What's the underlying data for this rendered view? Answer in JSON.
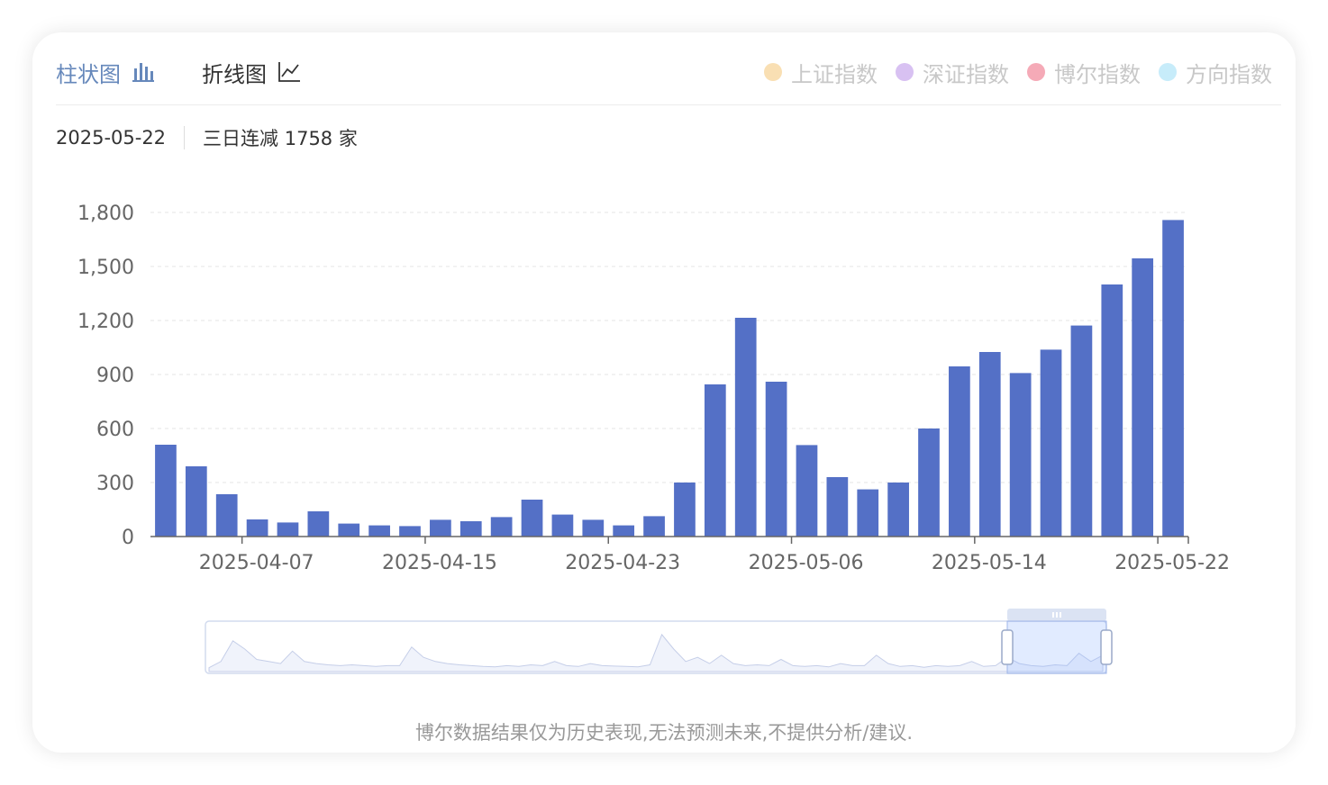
{
  "tabs": {
    "bar_label": "柱状图",
    "line_label": "折线图"
  },
  "legend": [
    {
      "label": "上证指数",
      "color": "#f9dfb3"
    },
    {
      "label": "深证指数",
      "color": "#d8c1f2"
    },
    {
      "label": "博尔指数",
      "color": "#f5aab7"
    },
    {
      "label": "方向指数",
      "color": "#c7ecfa"
    }
  ],
  "info": {
    "date": "2025-05-22",
    "summary": "三日连减 1758 家"
  },
  "footer": "博尔数据结果仅为历史表现,无法预测未来,不提供分析/建议.",
  "colors": {
    "bar": "#5470c6",
    "active_tab": "#6688bb"
  },
  "chart_data": {
    "type": "bar",
    "x_tick_labels": [
      "2025-04-07",
      "2025-04-15",
      "2025-04-23",
      "2025-05-06",
      "2025-05-14",
      "2025-05-22"
    ],
    "x_tick_positions": [
      3,
      9,
      15,
      21,
      27,
      33
    ],
    "values": [
      510,
      390,
      235,
      95,
      78,
      140,
      72,
      62,
      58,
      93,
      85,
      108,
      205,
      122,
      93,
      62,
      113,
      300,
      845,
      1215,
      860,
      508,
      330,
      262,
      300,
      600,
      945,
      1025,
      908,
      1038,
      1172,
      1400,
      1545,
      1758
    ],
    "ylim": [
      0,
      1800
    ],
    "yticks": [
      0,
      300,
      600,
      900,
      1200,
      1500,
      1800
    ],
    "ytick_labels": [
      "0",
      "300",
      "600",
      "900",
      "1,200",
      "1,500",
      "1,800"
    ],
    "grid": true,
    "datazoom_range_pct": [
      89,
      100
    ]
  }
}
